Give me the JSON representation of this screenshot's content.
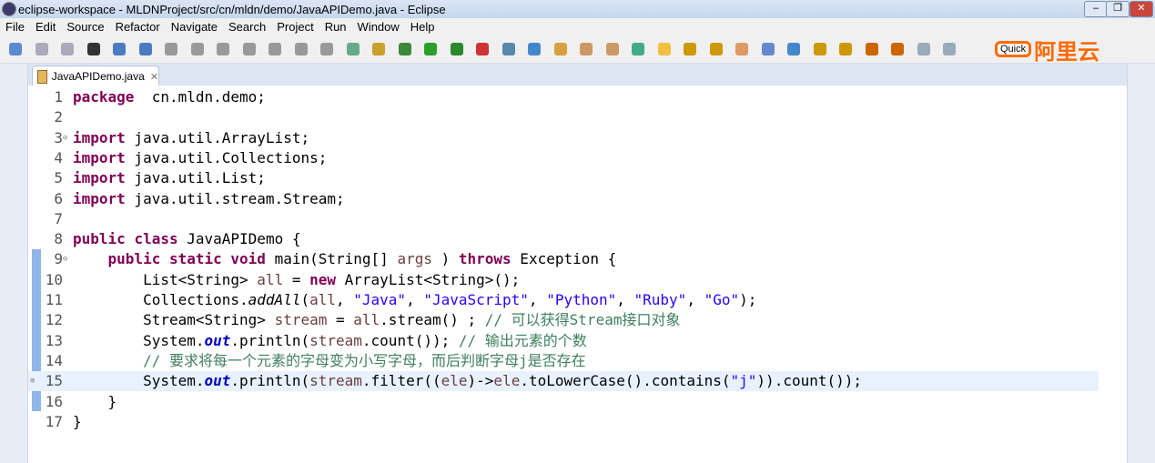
{
  "window": {
    "title": "eclipse-workspace - MLDNProject/src/cn/mldn/demo/JavaAPIDemo.java - Eclipse"
  },
  "menu": [
    "File",
    "Edit",
    "Source",
    "Refactor",
    "Navigate",
    "Search",
    "Project",
    "Run",
    "Window",
    "Help"
  ],
  "toolbar": {
    "quick_access": "Quick",
    "logo_text": "阿里云"
  },
  "editor": {
    "tab_label": "JavaAPIDemo.java",
    "accent": "#8fb5ea",
    "current_line": 15,
    "lines": [
      [
        [
          "kw",
          "package"
        ],
        [
          "",
          "  cn.mldn.demo;"
        ]
      ],
      [],
      [
        [
          "kw",
          "import"
        ],
        [
          "",
          " java.util.ArrayList;"
        ]
      ],
      [
        [
          "kw",
          "import"
        ],
        [
          "",
          " java.util.Collections;"
        ]
      ],
      [
        [
          "kw",
          "import"
        ],
        [
          "",
          " java.util.List;"
        ]
      ],
      [
        [
          "kw",
          "import"
        ],
        [
          "",
          " java.util.stream.Stream;"
        ]
      ],
      [],
      [
        [
          "kw",
          "public"
        ],
        [
          "",
          " "
        ],
        [
          "kw",
          "class"
        ],
        [
          "",
          " JavaAPIDemo {"
        ]
      ],
      [
        [
          "",
          "    "
        ],
        [
          "kw",
          "public"
        ],
        [
          "",
          " "
        ],
        [
          "kw",
          "static"
        ],
        [
          "",
          " "
        ],
        [
          "kw",
          "void"
        ],
        [
          "",
          " main(String[] "
        ],
        [
          "var",
          "args"
        ],
        [
          "",
          " ) "
        ],
        [
          "kw",
          "throws"
        ],
        [
          "",
          " Exception {"
        ]
      ],
      [
        [
          "",
          "        List<String> "
        ],
        [
          "var",
          "all"
        ],
        [
          "",
          " = "
        ],
        [
          "kw",
          "new"
        ],
        [
          "",
          " ArrayList<String>();"
        ]
      ],
      [
        [
          "",
          "        Collections."
        ],
        [
          "it",
          "addAll"
        ],
        [
          "",
          "("
        ],
        [
          "var",
          "all"
        ],
        [
          "",
          ", "
        ],
        [
          "str",
          "\"Java\""
        ],
        [
          "",
          ", "
        ],
        [
          "str",
          "\"JavaScript\""
        ],
        [
          "",
          ", "
        ],
        [
          "str",
          "\"Python\""
        ],
        [
          "",
          ", "
        ],
        [
          "str",
          "\"Ruby\""
        ],
        [
          "",
          ", "
        ],
        [
          "str",
          "\"Go\""
        ],
        [
          "",
          ");"
        ]
      ],
      [
        [
          "",
          "        Stream<String> "
        ],
        [
          "var",
          "stream"
        ],
        [
          "",
          " = "
        ],
        [
          "var",
          "all"
        ],
        [
          "",
          ".stream() ; "
        ],
        [
          "cm",
          "// 可以获得Stream接口对象"
        ]
      ],
      [
        [
          "",
          "        System."
        ],
        [
          "fld",
          "out"
        ],
        [
          "",
          ".println("
        ],
        [
          "var",
          "stream"
        ],
        [
          "",
          ".count()); "
        ],
        [
          "cm",
          "// 输出元素的个数"
        ]
      ],
      [
        [
          "",
          "        "
        ],
        [
          "cm",
          "// 要求将每一个元素的字母变为小写字母，而后判断字母j是否存在"
        ]
      ],
      [
        [
          "",
          "        System."
        ],
        [
          "fld",
          "out"
        ],
        [
          "",
          ".println("
        ],
        [
          "var",
          "stream"
        ],
        [
          "",
          ".filter(("
        ],
        [
          "var",
          "ele"
        ],
        [
          "",
          ")->"
        ],
        [
          "var",
          "ele"
        ],
        [
          "",
          ".toLowerCase().contains("
        ],
        [
          "str",
          "\"j\""
        ],
        [
          "",
          "))"
        ],
        [
          "",
          ".count());"
        ]
      ],
      [
        [
          "",
          "    }"
        ]
      ],
      [
        [
          "",
          "}"
        ]
      ]
    ]
  }
}
